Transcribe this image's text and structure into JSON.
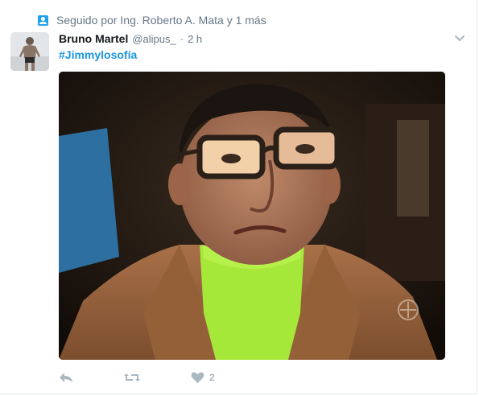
{
  "context": {
    "text": "Seguido por Ing. Roberto A. Mata y 1 más"
  },
  "tweet": {
    "name": "Bruno Martel",
    "handle": "@alipus_",
    "separator": "·",
    "time": "2 h",
    "hashtag": "#Jimmylosofía"
  },
  "actions": {
    "like_count": "2"
  },
  "icons": {
    "follow": "person-icon",
    "menu": "chevron-down-icon",
    "reply": "reply-icon",
    "retweet": "retweet-icon",
    "like": "heart-icon"
  },
  "colors": {
    "link": "#1b95e0",
    "muted": "#657786",
    "action": "#aab8c2",
    "accent": "#1da1f2"
  }
}
